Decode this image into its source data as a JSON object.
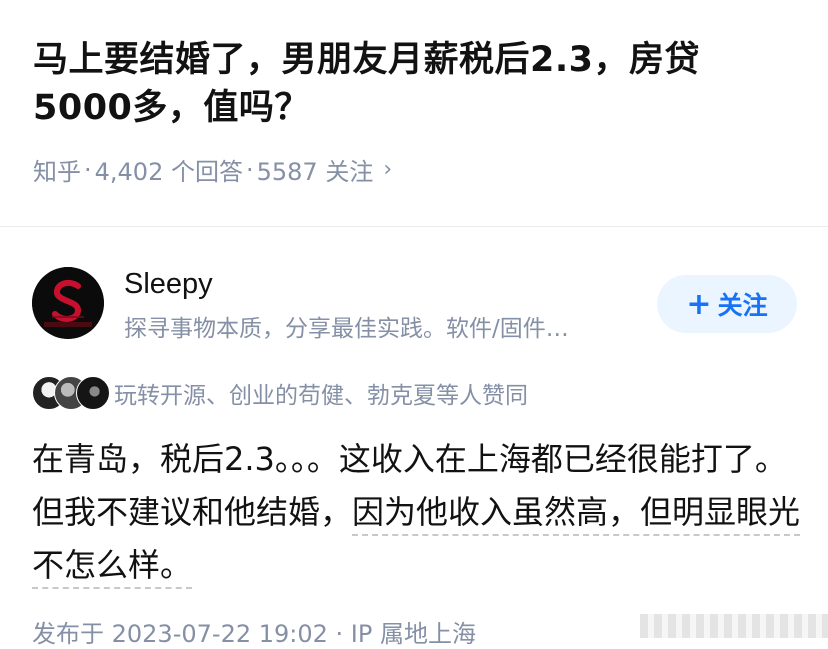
{
  "question": {
    "title": "马上要结婚了，男朋友月薪税后2.3，房贷5000多，值吗？"
  },
  "meta": {
    "source": "知乎",
    "answers": "4,402 个回答",
    "followers": "5587 关注",
    "chevron": "›"
  },
  "author": {
    "name": "Sleepy",
    "bio": "探寻事物本质，分享最佳实践。软件/固件…",
    "avatar_icon": "avatar-logo-icon"
  },
  "follow_button": {
    "label": "关注",
    "plus": "+"
  },
  "voters": {
    "text": "玩转开源、创业的苟健、勃克夏等人赞同"
  },
  "answer": {
    "text_part1": "在青岛，税后2.3。。。这收入在上海都已经很能打了。但我不建议和他结婚，",
    "text_part2": "因为他收入虽然高，但明显眼光不怎么样。"
  },
  "timestamp": "发布于 2023-07-22 19:02 · IP 属地上海",
  "colors": {
    "accent": "#1772f6",
    "follow_bg": "#ebf5ff",
    "muted": "#8590a6"
  }
}
